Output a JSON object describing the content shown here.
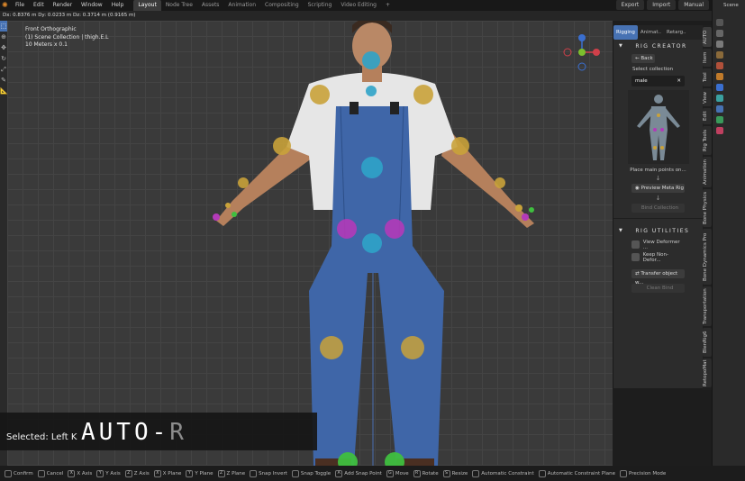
{
  "menu": {
    "items": [
      "File",
      "Edit",
      "Render",
      "Window",
      "Help"
    ],
    "workspaces": [
      "Layout",
      "Node Tree",
      "Assets",
      "Animation",
      "Compositing",
      "Scripting",
      "Video Editing",
      "+"
    ],
    "active_workspace": "Layout",
    "right_buttons": [
      "Export",
      "Import",
      "Manual"
    ],
    "scene_label": "Scene"
  },
  "header": {
    "transform_readout": "Dx: 0.8376 m   Dy: 0.0233 m   Dz: 0.3714 m (0.9165 m)"
  },
  "viewport": {
    "view_name": "Front Orthographic",
    "collection_info": "(1) Scene Collection | thigh.E.L",
    "scale_info": "10 Meters x 0.1"
  },
  "overlay": {
    "selected_text": "Selected: Left K",
    "auto_main": "AUTO-",
    "auto_faded": "R"
  },
  "panel": {
    "tabs": [
      "Rigging",
      "Animat..",
      "Retarg.."
    ],
    "rig_creator_title": "RIG CREATOR",
    "back_label": "Back",
    "select_collection_label": "Select collection",
    "collection_value": "male",
    "place_points_text": "Place main points on...",
    "preview_button": "Preview Meta Rig",
    "bind_button": "Bind Collection",
    "rig_utilities_title": "RIG UTILITIES",
    "view_deformer_label": "View Deformer ...",
    "keep_non_deform_label": "Keep Non-Defor...",
    "transfer_button": "Transfer object w...",
    "clean_bind_button": "Clean Bind"
  },
  "vertical_tabs": [
    "RetopoMat",
    "BlenRig6",
    "Transportation",
    "Bone Dynamics Pro",
    "Bone Physics",
    "Animation",
    "Rig Tools",
    "Edit",
    "View",
    "Tool",
    "Item",
    "AUTO"
  ],
  "statusbar": {
    "items": [
      {
        "key": "",
        "label": "Confirm"
      },
      {
        "key": "",
        "label": "Cancel"
      },
      {
        "key": "X",
        "label": "X Axis"
      },
      {
        "key": "Y",
        "label": "Y Axis"
      },
      {
        "key": "Z",
        "label": "Z Axis"
      },
      {
        "key": "X",
        "label": "X Plane"
      },
      {
        "key": "Y",
        "label": "Y Plane"
      },
      {
        "key": "Z",
        "label": "Z Plane"
      },
      {
        "key": "",
        "label": "Snap Invert"
      },
      {
        "key": "",
        "label": "Snap Toggle"
      },
      {
        "key": "A",
        "label": "Add Snap Point"
      },
      {
        "key": "G",
        "label": "Move"
      },
      {
        "key": "R",
        "label": "Rotate"
      },
      {
        "key": "S",
        "label": "Resize"
      },
      {
        "key": "",
        "label": "Automatic Constraint"
      },
      {
        "key": "",
        "label": "Automatic Constraint Plane"
      },
      {
        "key": "",
        "label": "Precision Mode"
      }
    ]
  },
  "colors": {
    "accent": "#4772b3",
    "joint_yellow": "#c9a23a",
    "joint_cyan": "#2fa3c8",
    "joint_magenta": "#b33ab8",
    "joint_green": "#3fbf3f"
  }
}
